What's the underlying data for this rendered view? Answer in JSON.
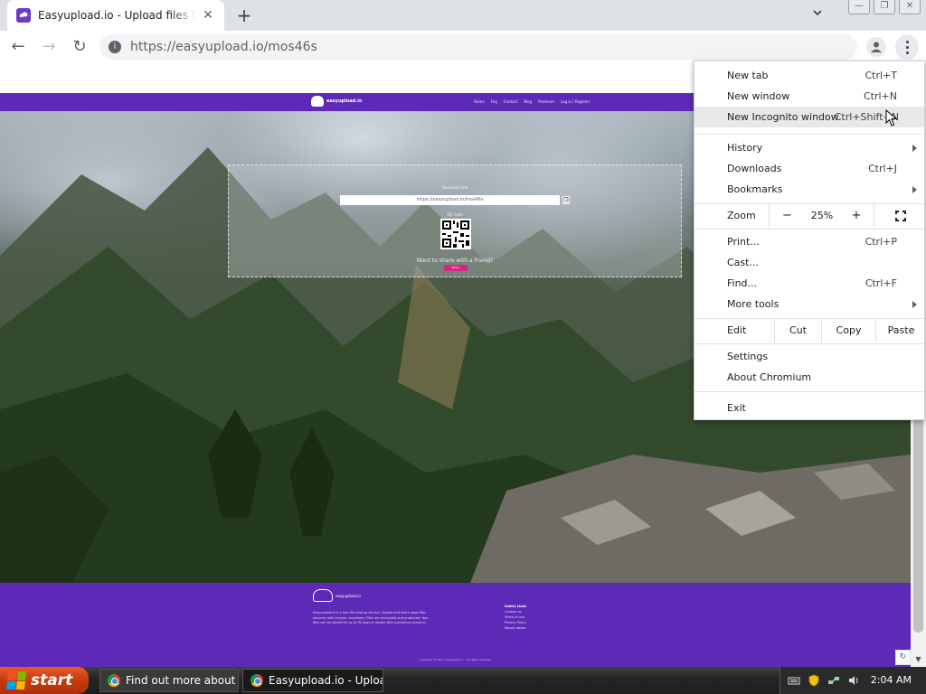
{
  "browser": {
    "tab_title": "Easyupload.io - Upload files for free",
    "tab_close": "✕",
    "new_tab": "+",
    "url": "https://easyupload.io/mos46s"
  },
  "window_controls": {
    "minimize": "—",
    "restore": "❐",
    "close": "✕"
  },
  "nav": {
    "back": "←",
    "forward": "→",
    "reload": "↻"
  },
  "site": {
    "brand": "easyupload.io",
    "nav_items": [
      "Home",
      "Faq",
      "Contact",
      "Blog",
      "Premium",
      "Log in / Register"
    ],
    "panel_label": "Download link",
    "share_url": "https://easyupload.io/mos46s",
    "qr_label": "QR Code",
    "share_prompt": "Want to share with a friend?",
    "share_button": "Share",
    "footer_brand": "easyupload.io",
    "footer_text": "Easyupload.io is a free file hosting service. Upload and share large files securely with anyone, anywhere. Files are encrypted and protected. Your files can be stored for up to 30 days or longer with a premium account.",
    "footer_links_heading": "Useful Links",
    "footer_links": [
      "Contact us",
      "Terms of use",
      "Privacy Policy",
      "Report abuse"
    ],
    "footer_copy": "Copyright © 2021 easyupload.io - All rights reserved"
  },
  "menu": {
    "items_top": [
      {
        "label": "New tab",
        "shortcut": "Ctrl+T"
      },
      {
        "label": "New window",
        "shortcut": "Ctrl+N"
      },
      {
        "label": "New Incognito window",
        "shortcut": "Ctrl+Shift+N"
      }
    ],
    "items_mid": [
      {
        "label": "History",
        "shortcut": ""
      },
      {
        "label": "Downloads",
        "shortcut": "Ctrl+J"
      },
      {
        "label": "Bookmarks",
        "shortcut": ""
      }
    ],
    "zoom": {
      "label": "Zoom",
      "minus": "−",
      "value": "25%",
      "plus": "+"
    },
    "items_tools": [
      {
        "label": "Print...",
        "shortcut": "Ctrl+P"
      },
      {
        "label": "Cast...",
        "shortcut": ""
      },
      {
        "label": "Find...",
        "shortcut": "Ctrl+F"
      },
      {
        "label": "More tools",
        "shortcut": ""
      }
    ],
    "edit": {
      "label": "Edit",
      "cut": "Cut",
      "copy": "Copy",
      "paste": "Paste"
    },
    "items_bottom": [
      {
        "label": "Settings",
        "shortcut": ""
      },
      {
        "label": "About Chromium",
        "shortcut": ""
      }
    ],
    "exit": "Exit"
  },
  "taskbar": {
    "start": "start",
    "tasks": [
      {
        "label": "Find out more about ..."
      },
      {
        "label": "Easyupload.io - Uploa..."
      }
    ],
    "clock": "2:04 AM"
  },
  "colors": {
    "brand_purple": "#5d2ab8",
    "share_pink": "#d6267f",
    "start_orange": "#c53b10"
  }
}
